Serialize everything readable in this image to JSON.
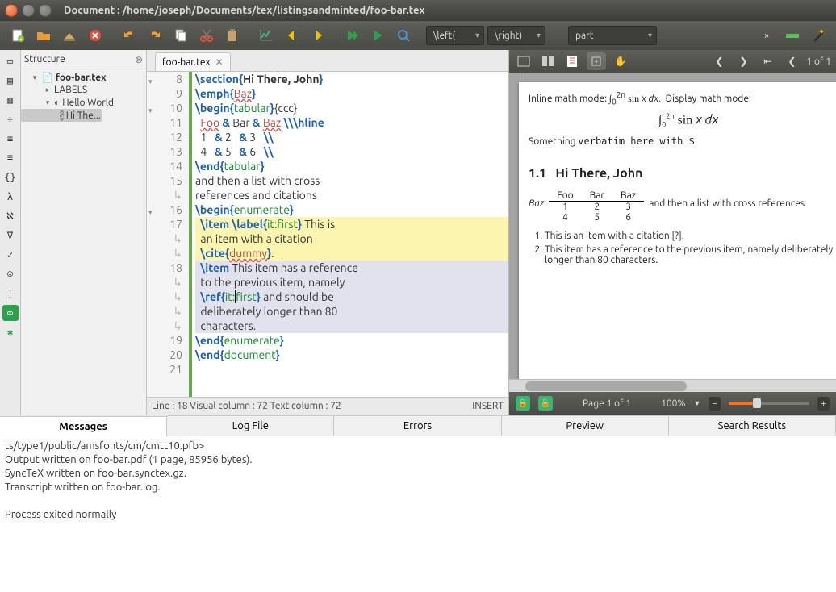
{
  "window": {
    "title": "Document : /home/joseph/Documents/tex/listingsandminted/foo-bar.tex"
  },
  "toolbar": {
    "dropdowns": {
      "left": "\\left(",
      "right": "\\right)",
      "part": "part"
    }
  },
  "structure": {
    "title": "Structure",
    "root": "foo-bar.tex",
    "labels": "LABELS",
    "hello": "Hello World",
    "hi": "Hi The..."
  },
  "tab": {
    "name": "foo-bar.tex"
  },
  "editor": {
    "lines": [
      {
        "n": "8",
        "fold": "▾",
        "html": "<span class='kw-cmd'>\\section{</span><b>Hi There, John</b><span class='kw-cmd'>}</span>"
      },
      {
        "n": "9",
        "html": "<span class='kw-cmd'>\\emph{</span><span class='spell'>Baz</span><span class='kw-cmd'>}</span>"
      },
      {
        "n": "10",
        "fold": "▾",
        "html": "<span class='kw-cmd'>\\begin{</span><span class='kw-arg'>tabular</span><span class='kw-cmd'>}</span>{ccc}"
      },
      {
        "n": "11",
        "html": "  <span class='spell'>Foo</span> <span class='amp'>&amp;</span> Bar <span class='amp'>&amp;</span> <span class='spell'>Baz</span> <span class='kw-cmd'>\\\\\\hline</span>"
      },
      {
        "n": "12",
        "html": "  1   <span class='amp'>&amp;</span> 2   <span class='amp'>&amp;</span> 3   <span class='kw-cmd'>\\\\</span>"
      },
      {
        "n": "13",
        "html": "  4   <span class='amp'>&amp;</span> 5   <span class='amp'>&amp;</span> 6   <span class='kw-cmd'>\\\\</span>"
      },
      {
        "n": "14",
        "html": "<span class='kw-cmd'>\\end{</span><span class='kw-arg'>tabular</span><span class='kw-cmd'>}</span>"
      },
      {
        "n": "15",
        "html": "and then a list with cross "
      },
      {
        "n": "",
        "sub": true,
        "html": "references and citations"
      },
      {
        "n": "16",
        "fold": "▾",
        "html": "<span class='kw-cmd'>\\begin{</span><span class='kw-arg'>enumerate</span><span class='kw-cmd'>}</span>"
      },
      {
        "n": "17",
        "warn": true,
        "cls": "hl-yellow",
        "html": "  <span class='kw-cmd'>\\item</span> <span class='kw-cmd'>\\label{</span><span class='kw-arg'>it:first</span><span class='kw-cmd'>}</span> This is "
      },
      {
        "n": "",
        "sub": true,
        "cls": "hl-yellow",
        "html": "  an item with a citation "
      },
      {
        "n": "",
        "sub": true,
        "cls": "hl-yellow",
        "html": "  <span class='kw-cmd'>\\cite{</span><span class='spell'>dummy</span><span class='kw-cmd'>}</span>."
      },
      {
        "n": "18",
        "cls": "hl-blue",
        "html": "  <span class='kw-cmd'>\\item</span> This item has a reference "
      },
      {
        "n": "",
        "sub": true,
        "cls": "hl-blue",
        "html": "  to the previous item, namely "
      },
      {
        "n": "",
        "sub": true,
        "cls": "hl-blue",
        "html": "  <span class='kw-cmd'>\\ref{</span><span class='kw-arg'>it:<span class='cursor'></span>first</span><span class='kw-cmd'>}</span> and should be "
      },
      {
        "n": "",
        "sub": true,
        "cls": "hl-blue",
        "html": "  deliberately longer than 80 "
      },
      {
        "n": "",
        "sub": true,
        "cls": "hl-blue",
        "html": "  characters."
      },
      {
        "n": "19",
        "html": "<span class='kw-cmd'>\\end{</span><span class='kw-arg'>enumerate</span><span class='kw-cmd'>}</span>"
      },
      {
        "n": "20",
        "html": "<span class='kw-cmd'>\\end{</span><span class='kw-arg'>document</span><span class='kw-cmd'>}</span>"
      },
      {
        "n": "21",
        "html": ""
      }
    ],
    "status_left": "Line : 18 Visual column : 72 Text column : 72",
    "status_right": "INSERT"
  },
  "preview": {
    "page_label_top": "1 of 1",
    "page_label_bottom": "Page 1 of 1",
    "zoom": "100%",
    "inline_text": "Inline math mode:",
    "display_text": "Display math mode:",
    "something": "Something ",
    "verbatim": "verbatim here with $",
    "section_no": "1.1",
    "section_title": "Hi There, John",
    "table": {
      "head": [
        "Foo",
        "Bar",
        "Baz"
      ],
      "rowlabel": "Baz",
      "rows": [
        [
          "1",
          "2",
          "3"
        ],
        [
          "4",
          "5",
          "6"
        ]
      ]
    },
    "trail": "and then a list with cross references",
    "item1": "This is an item with a citation [?].",
    "item2": "This item has a reference to the previous item, namely deliberately longer than 80 characters."
  },
  "bottom": {
    "tabs": [
      "Messages",
      "Log File",
      "Errors",
      "Preview",
      "Search Results"
    ],
    "log_lines": [
      "ts/type1/public/amsfonts/cm/cmtt10.pfb>",
      "Output written on foo-bar.pdf (1 page, 85956 bytes).",
      "SyncTeX written on foo-bar.synctex.gz.",
      "Transcript written on foo-bar.log.",
      "",
      "Process exited normally"
    ]
  }
}
